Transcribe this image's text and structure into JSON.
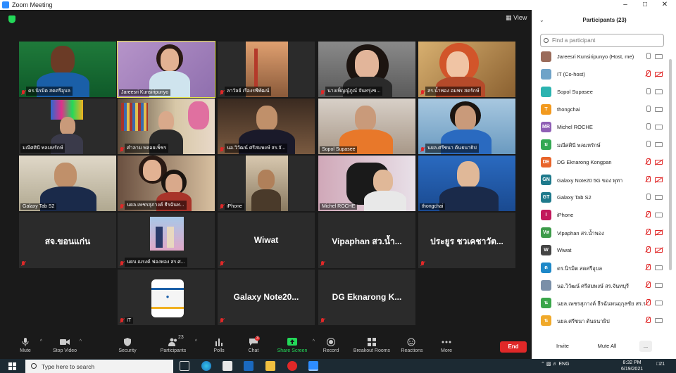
{
  "window": {
    "title": "Zoom Meeting",
    "controls": [
      "–",
      "□",
      "✕"
    ]
  },
  "view_label": "View",
  "tiles": [
    {
      "name": "ดร.นิรมิต สดศรีอุบล",
      "muted": true,
      "video": true
    },
    {
      "name": "Jareesri Kunsiripunyo",
      "muted": false,
      "video": true,
      "active": true
    },
    {
      "name": "ลาวัลย์ เรืองรพีพัฒน์",
      "muted": true,
      "video": true
    },
    {
      "name": "นางเพ็ญญ์ภูณ์ จันทรุ่งข...",
      "muted": true,
      "video": true
    },
    {
      "name": "สร.น้ำพอง อมพร สดรักษ์",
      "muted": true,
      "video": true
    },
    {
      "name": "มณีศศินี พลมหรักษ์",
      "muted": false,
      "video": true
    },
    {
      "name": "คำลาม พลอยเพ็ชร",
      "muted": true,
      "video": true
    },
    {
      "name": "นอ.วิวัฒน์ ศรีสมพงษ์ สร.จั...",
      "muted": true,
      "video": true
    },
    {
      "name": "Sopol Supasee",
      "muted": false,
      "video": true
    },
    {
      "name": "นยล.ศรีชนา ต้นธนาธิป",
      "muted": true,
      "video": true
    },
    {
      "name": "Galaxy Tab S2",
      "muted": false,
      "video": true
    },
    {
      "name": "นยล.เพชรสุภางค์ ธีรฉันท...",
      "muted": true,
      "video": true
    },
    {
      "name": "iPhone",
      "muted": true,
      "video": true
    },
    {
      "name": "Michel ROCHE",
      "muted": false,
      "video": true
    },
    {
      "name": "thongchai",
      "muted": false,
      "video": true
    },
    {
      "name": "สจ.ขอนแก่น",
      "muted": true,
      "video": false,
      "big": "สจ.ขอนแก่น"
    },
    {
      "name": "นยบ.ณรงค์ ฟองทอง สร.ศ...",
      "muted": true,
      "video": true
    },
    {
      "name": "Wiwat",
      "muted": true,
      "video": false,
      "big": "Wiwat"
    },
    {
      "name": "Vipaphan",
      "muted": true,
      "video": false,
      "big": "Vipaphan  สว.น้ำ..."
    },
    {
      "name": "ประยูร",
      "muted": true,
      "video": false,
      "big": "ประยูร ชวเคชาวัต..."
    },
    {
      "name": "IT",
      "muted": true,
      "video": true
    },
    {
      "name": "Galaxy Note20",
      "muted": true,
      "video": false,
      "big": "Galaxy  Note20..."
    },
    {
      "name": "DG Eknarong",
      "muted": true,
      "video": false,
      "big": "DG Eknarong K..."
    }
  ],
  "toolbar": {
    "mute": "Mute",
    "stop_video": "Stop Video",
    "security": "Security",
    "participants": "Participants",
    "participants_count": "23",
    "polls": "Polls",
    "chat": "Chat",
    "chat_badge": "3",
    "share_screen": "Share Screen",
    "record": "Record",
    "breakout_rooms": "Breakout Rooms",
    "reactions": "Reactions",
    "more": "More",
    "end": "End"
  },
  "panel": {
    "title": "Participants (23)",
    "search_placeholder": "Find a participant",
    "invite": "Invite",
    "mute_all": "Mute All",
    "more": "...",
    "participants": [
      {
        "name": "Jareesri Kunsiripunyo (Host, me)",
        "initials": "",
        "color": "#9a6b5a",
        "mic_muted": false,
        "cam_muted": false
      },
      {
        "name": "IT (Co-host)",
        "initials": "",
        "color": "#6fa3c8",
        "mic_muted": true,
        "cam_muted": true
      },
      {
        "name": "Sopol Supasee",
        "initials": "",
        "color": "#2bb3b0",
        "mic_muted": false,
        "cam_muted": false
      },
      {
        "name": "thongchai",
        "initials": "T",
        "color": "#f29a1f",
        "mic_muted": false,
        "cam_muted": false
      },
      {
        "name": "Michel ROCHE",
        "initials": "MR",
        "color": "#8f5fb5",
        "mic_muted": false,
        "cam_muted": false
      },
      {
        "name": "มณีศศินี พลมหรักษ์",
        "initials": "ม",
        "color": "#34a853",
        "mic_muted": false,
        "cam_muted": false
      },
      {
        "name": "DG Eknarong Kongpan",
        "initials": "DE",
        "color": "#e8642a",
        "mic_muted": true,
        "cam_muted": true
      },
      {
        "name": "Galaxy Note20 5G ของ พุทา",
        "initials": "GN",
        "color": "#1f7a8c",
        "mic_muted": true,
        "cam_muted": true
      },
      {
        "name": "Galaxy Tab S2",
        "initials": "GT",
        "color": "#1f7a8c",
        "mic_muted": false,
        "cam_muted": false
      },
      {
        "name": "iPhone",
        "initials": "I",
        "color": "#c2185b",
        "mic_muted": true,
        "cam_muted": false
      },
      {
        "name": "Vipaphan  สร.น้ำพอง",
        "initials": "Vส",
        "color": "#3d9b4a",
        "mic_muted": true,
        "cam_muted": true
      },
      {
        "name": "Wiwat",
        "initials": "W",
        "color": "#444",
        "mic_muted": true,
        "cam_muted": true
      },
      {
        "name": "ดร.นิรมิต สดศรีอุบล",
        "initials": "ด",
        "color": "#1e88c8",
        "mic_muted": true,
        "cam_muted": false
      },
      {
        "name": "นอ.วิวัฒน์ ศรีสมพงษ์ สร.จันทบุรี",
        "initials": "",
        "color": "#7a8fa8",
        "mic_muted": true,
        "cam_muted": false
      },
      {
        "name": "นยล.เพชรสุภางค์ ธีรฉันทนฤกุลชัย สร.ร...",
        "initials": "น",
        "color": "#3aa64a",
        "mic_muted": true,
        "cam_muted": false
      },
      {
        "name": "นยล.ศรีชนา ต้นธนาธิป",
        "initials": "น",
        "color": "#f0a92a",
        "mic_muted": true,
        "cam_muted": false
      }
    ]
  },
  "taskbar": {
    "search_placeholder": "Type here to search",
    "lang": "ENG",
    "time": "8:32 PM",
    "date": "6/19/2021",
    "notif": "21"
  }
}
